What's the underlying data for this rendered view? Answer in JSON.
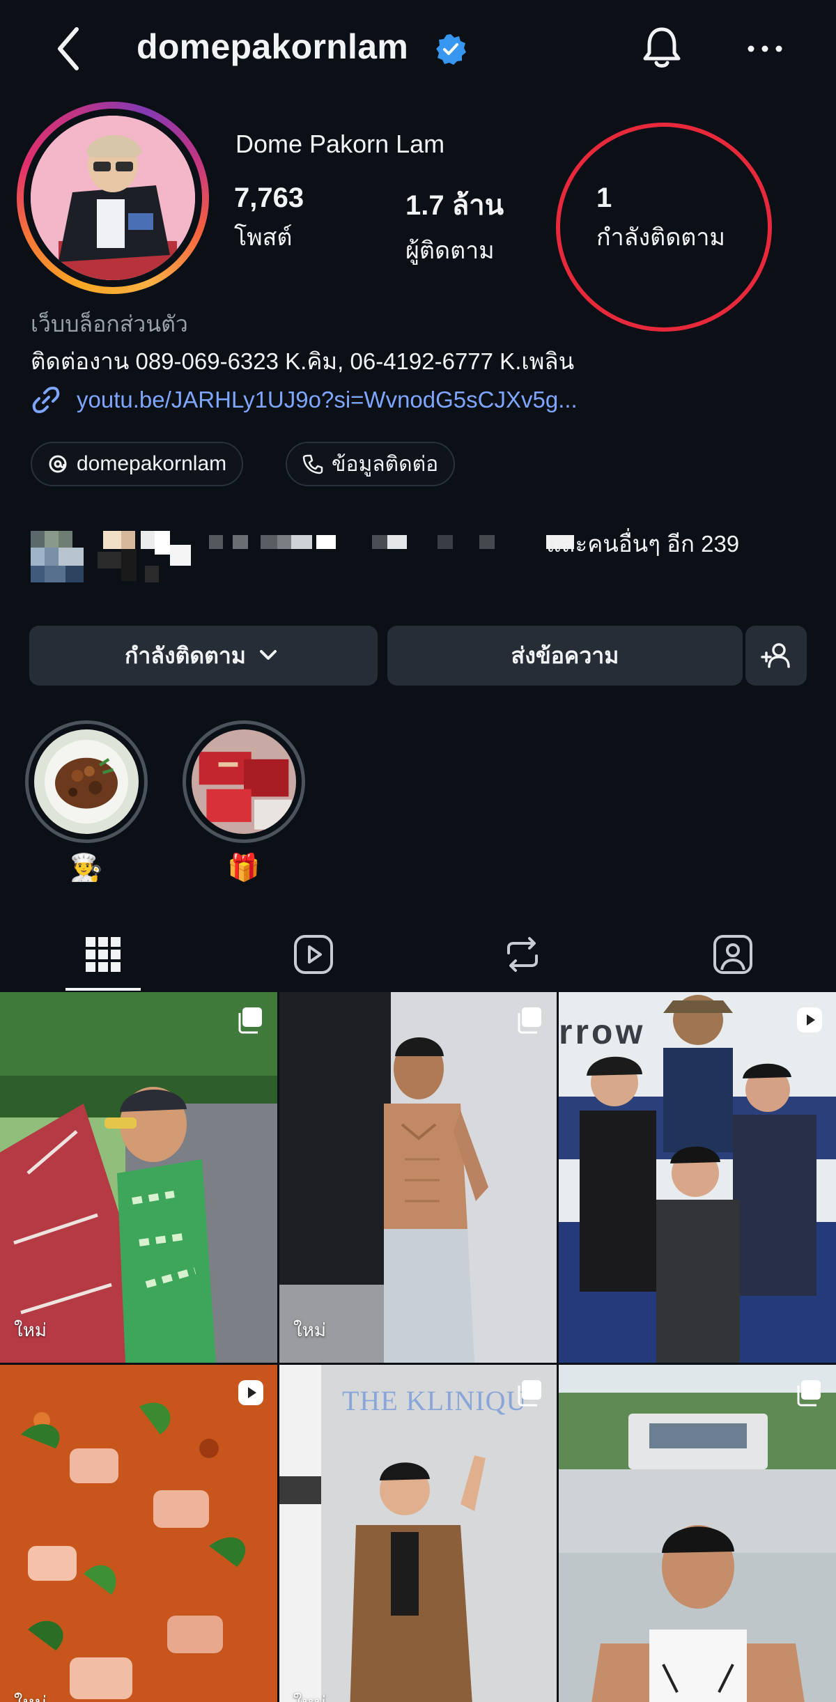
{
  "header": {
    "username": "domepakornlam",
    "back_icon": "chevron-left-icon",
    "verified_icon": "verified-badge-icon",
    "notification_icon": "bell-icon",
    "more_icon": "more-horizontal-icon"
  },
  "profile": {
    "full_name": "Dome Pakorn Lam",
    "stats": [
      {
        "value": "7,763",
        "label": "โพสต์"
      },
      {
        "value": "1.7 ล้าน",
        "label": "ผู้ติดตาม"
      },
      {
        "value": "1",
        "label": "กำลังติดตาม"
      }
    ],
    "category": "เว็บบล็อกส่วนตัว",
    "contact": "ติดต่องาน 089-069-6323 K.คิม, 06-4192-6777 K.เพลิน",
    "link": "youtu.be/JARHLy1UJ9o?si=WvnodG5sCJXv5g...",
    "threads_chip": "domepakornlam",
    "contact_chip": "ข้อมูลติดต่อ",
    "followed_by_text": "และคนอื่นๆ อีก 239",
    "annotation_color": "#e8293b"
  },
  "actions": {
    "following_label": "กำลังติดตาม",
    "message_label": "ส่งข้อความ",
    "suggest_icon": "add-person-icon"
  },
  "highlights": [
    {
      "emoji": "👨‍🍳"
    },
    {
      "emoji": "🎁"
    }
  ],
  "tabs": [
    {
      "icon": "grid-icon",
      "active": true
    },
    {
      "icon": "reels-icon",
      "active": false
    },
    {
      "icon": "repost-icon",
      "active": false
    },
    {
      "icon": "tagged-icon",
      "active": false
    }
  ],
  "posts": [
    {
      "type": "carousel",
      "label": "ใหม่"
    },
    {
      "type": "carousel",
      "label": "ใหม่"
    },
    {
      "type": "reel",
      "label": "",
      "sign_text": "rrow"
    },
    {
      "type": "reel",
      "label": "ใหม่"
    },
    {
      "type": "carousel",
      "label": "ใหม่",
      "sign_text": "THE KLINIQU"
    },
    {
      "type": "carousel",
      "label": ""
    }
  ],
  "colors": {
    "background": "#0b0f16",
    "button": "#262d36",
    "link": "#7fa6ff",
    "verified": "#3797f0"
  }
}
